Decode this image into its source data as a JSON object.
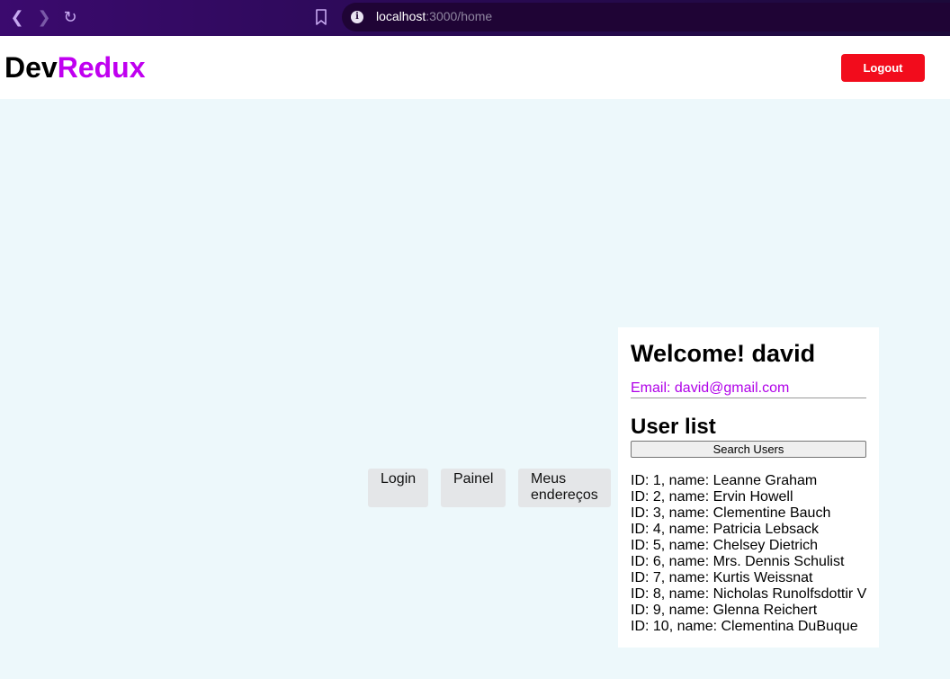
{
  "browser": {
    "url_host": "localhost",
    "url_rest": ":3000/home"
  },
  "header": {
    "logo_part1": "Dev",
    "logo_part2": "Redux",
    "logout_label": "Logout"
  },
  "nav": {
    "login": "Login",
    "painel": "Painel",
    "meus_line1": "Meus",
    "meus_line2": "endereços"
  },
  "card": {
    "welcome": "Welcome! david",
    "email": "Email: david@gmail.com",
    "user_list_title": "User list",
    "search_label": "Search Users",
    "users": [
      "ID: 1, name: Leanne Graham",
      "ID: 2, name: Ervin Howell",
      "ID: 3, name: Clementine Bauch",
      "ID: 4, name: Patricia Lebsack",
      "ID: 5, name: Chelsey Dietrich",
      "ID: 6, name: Mrs. Dennis Schulist",
      "ID: 7, name: Kurtis Weissnat",
      "ID: 8, name: Nicholas Runolfsdottir V",
      "ID: 9, name: Glenna Reichert",
      "ID: 10, name: Clementina DuBuque"
    ]
  },
  "colors": {
    "brand_accent": "#c000f0",
    "logout_red": "#f20c1c",
    "page_bg": "#edf8fb"
  }
}
